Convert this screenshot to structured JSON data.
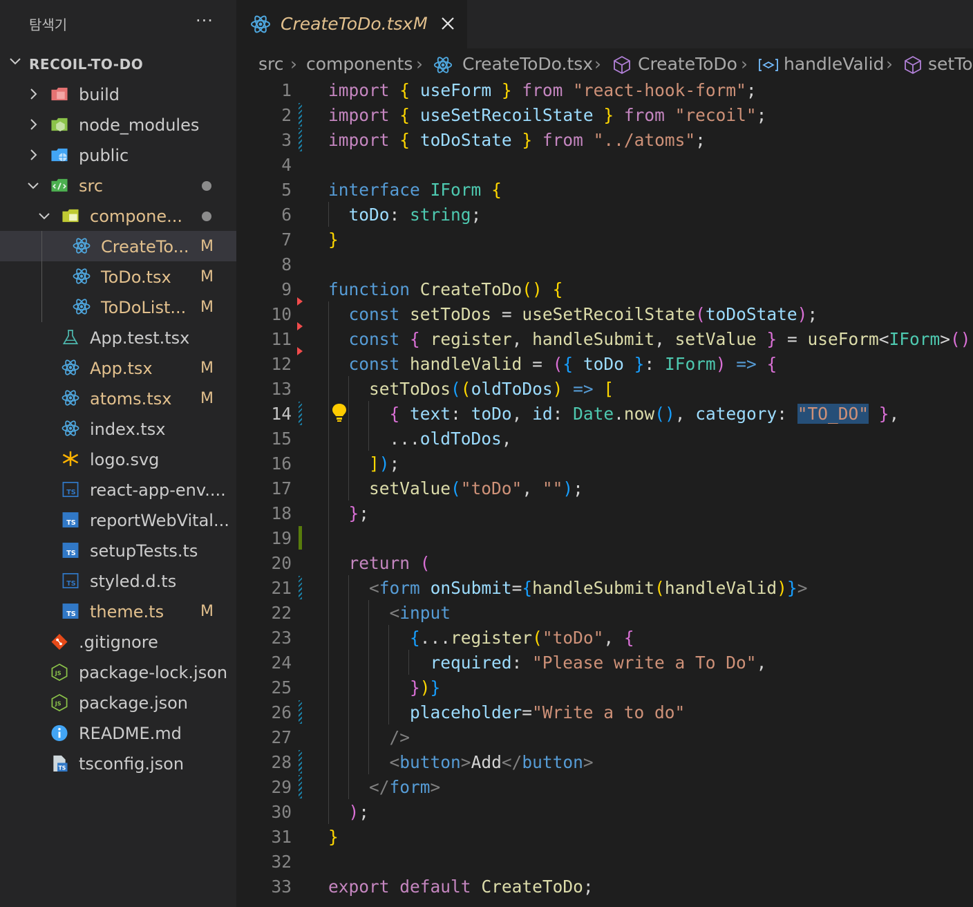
{
  "sidebar": {
    "title": "탐색기",
    "more": "···",
    "root": "RECOIL-TO-DO",
    "items": [
      {
        "label": "build",
        "badge": "",
        "color": "#cccccc"
      },
      {
        "label": "node_modules",
        "badge": "",
        "color": "#cccccc"
      },
      {
        "label": "public",
        "badge": "",
        "color": "#cccccc"
      },
      {
        "label": "src",
        "badge": "",
        "color": "#e2c08d"
      },
      {
        "label": "compone...",
        "badge": "",
        "color": "#e2c08d"
      },
      {
        "label": "CreateTo...",
        "badge": "M",
        "color": "#e2c08d"
      },
      {
        "label": "ToDo.tsx",
        "badge": "M",
        "color": "#e2c08d"
      },
      {
        "label": "ToDoList...",
        "badge": "M",
        "color": "#e2c08d"
      },
      {
        "label": "App.test.tsx",
        "badge": "",
        "color": "#cccccc"
      },
      {
        "label": "App.tsx",
        "badge": "M",
        "color": "#e2c08d"
      },
      {
        "label": "atoms.tsx",
        "badge": "M",
        "color": "#e2c08d"
      },
      {
        "label": "index.tsx",
        "badge": "",
        "color": "#cccccc"
      },
      {
        "label": "logo.svg",
        "badge": "",
        "color": "#cccccc"
      },
      {
        "label": "react-app-env....",
        "badge": "",
        "color": "#cccccc"
      },
      {
        "label": "reportWebVital...",
        "badge": "",
        "color": "#cccccc"
      },
      {
        "label": "setupTests.ts",
        "badge": "",
        "color": "#cccccc"
      },
      {
        "label": "styled.d.ts",
        "badge": "",
        "color": "#cccccc"
      },
      {
        "label": "theme.ts",
        "badge": "M",
        "color": "#e2c08d"
      },
      {
        "label": ".gitignore",
        "badge": "",
        "color": "#cccccc"
      },
      {
        "label": "package-lock.json",
        "badge": "",
        "color": "#cccccc"
      },
      {
        "label": "package.json",
        "badge": "",
        "color": "#cccccc"
      },
      {
        "label": "README.md",
        "badge": "",
        "color": "#cccccc"
      },
      {
        "label": "tsconfig.json",
        "badge": "",
        "color": "#cccccc"
      }
    ]
  },
  "tab": {
    "title": "CreateToDo.tsx",
    "badge": "M"
  },
  "breadcrumb": [
    "src",
    "components",
    "CreateToDo.tsx",
    "CreateToDo",
    "handleValid",
    "setTo"
  ],
  "code": {
    "active_line": 14,
    "lines": [
      [
        [
          "kw",
          "import"
        ],
        [
          "op",
          " "
        ],
        [
          "b1",
          "{"
        ],
        [
          "op",
          " "
        ],
        [
          "vr",
          "useForm"
        ],
        [
          "op",
          " "
        ],
        [
          "b1",
          "}"
        ],
        [
          "op",
          " "
        ],
        [
          "kw",
          "from"
        ],
        [
          "op",
          " "
        ],
        [
          "st",
          "\"react-hook-form\""
        ],
        [
          "op",
          ";"
        ]
      ],
      [
        [
          "kw",
          "import"
        ],
        [
          "op",
          " "
        ],
        [
          "b1",
          "{"
        ],
        [
          "op",
          " "
        ],
        [
          "vr",
          "useSetRecoilState"
        ],
        [
          "op",
          " "
        ],
        [
          "b1",
          "}"
        ],
        [
          "op",
          " "
        ],
        [
          "kw",
          "from"
        ],
        [
          "op",
          " "
        ],
        [
          "st",
          "\"recoil\""
        ],
        [
          "op",
          ";"
        ]
      ],
      [
        [
          "kw",
          "import"
        ],
        [
          "op",
          " "
        ],
        [
          "b1",
          "{"
        ],
        [
          "op",
          " "
        ],
        [
          "vr",
          "toDoState"
        ],
        [
          "op",
          " "
        ],
        [
          "b1",
          "}"
        ],
        [
          "op",
          " "
        ],
        [
          "kw",
          "from"
        ],
        [
          "op",
          " "
        ],
        [
          "st",
          "\"../atoms\""
        ],
        [
          "op",
          ";"
        ]
      ],
      [],
      [
        [
          "kb",
          "interface"
        ],
        [
          "op",
          " "
        ],
        [
          "ty",
          "IForm"
        ],
        [
          "op",
          " "
        ],
        [
          "b1",
          "{"
        ]
      ],
      [
        [
          "op",
          "  "
        ],
        [
          "vr",
          "toDo"
        ],
        [
          "op",
          ": "
        ],
        [
          "ty",
          "string"
        ],
        [
          "op",
          ";"
        ]
      ],
      [
        [
          "b1",
          "}"
        ]
      ],
      [],
      [
        [
          "kb",
          "function"
        ],
        [
          "op",
          " "
        ],
        [
          "fn",
          "CreateToDo"
        ],
        [
          "b1",
          "()"
        ],
        [
          "op",
          " "
        ],
        [
          "b1",
          "{"
        ]
      ],
      [
        [
          "op",
          "  "
        ],
        [
          "kb",
          "const"
        ],
        [
          "op",
          " "
        ],
        [
          "fn",
          "setToDos"
        ],
        [
          "op",
          " = "
        ],
        [
          "fn",
          "useSetRecoilState"
        ],
        [
          "b2",
          "("
        ],
        [
          "vr",
          "toDoState"
        ],
        [
          "b2",
          ")"
        ],
        [
          "op",
          ";"
        ]
      ],
      [
        [
          "op",
          "  "
        ],
        [
          "kb",
          "const"
        ],
        [
          "op",
          " "
        ],
        [
          "b2",
          "{"
        ],
        [
          "op",
          " "
        ],
        [
          "fn",
          "register"
        ],
        [
          "op",
          ", "
        ],
        [
          "fn",
          "handleSubmit"
        ],
        [
          "op",
          ", "
        ],
        [
          "fn",
          "setValue"
        ],
        [
          "op",
          " "
        ],
        [
          "b2",
          "}"
        ],
        [
          "op",
          " = "
        ],
        [
          "fn",
          "useForm"
        ],
        [
          "op",
          "<"
        ],
        [
          "ty",
          "IForm"
        ],
        [
          "op",
          ">"
        ],
        [
          "b2",
          "()"
        ],
        [
          "op",
          ";"
        ]
      ],
      [
        [
          "op",
          "  "
        ],
        [
          "kb",
          "const"
        ],
        [
          "op",
          " "
        ],
        [
          "fn",
          "handleValid"
        ],
        [
          "op",
          " = "
        ],
        [
          "b2",
          "("
        ],
        [
          "b3",
          "{"
        ],
        [
          "op",
          " "
        ],
        [
          "vr",
          "toDo"
        ],
        [
          "op",
          " "
        ],
        [
          "b3",
          "}"
        ],
        [
          "op",
          ": "
        ],
        [
          "ty",
          "IForm"
        ],
        [
          "b2",
          ")"
        ],
        [
          "op",
          " "
        ],
        [
          "kb",
          "=>"
        ],
        [
          "op",
          " "
        ],
        [
          "b2",
          "{"
        ]
      ],
      [
        [
          "op",
          "    "
        ],
        [
          "fn",
          "setToDos"
        ],
        [
          "b3",
          "("
        ],
        [
          "b1",
          "("
        ],
        [
          "vr",
          "oldToDos"
        ],
        [
          "b1",
          ")"
        ],
        [
          "op",
          " "
        ],
        [
          "kb",
          "=>"
        ],
        [
          "op",
          " "
        ],
        [
          "b1",
          "["
        ]
      ],
      [
        [
          "op",
          "      "
        ],
        [
          "b2",
          "{"
        ],
        [
          "op",
          " "
        ],
        [
          "vr",
          "text"
        ],
        [
          "op",
          ": "
        ],
        [
          "vr",
          "toDo"
        ],
        [
          "op",
          ", "
        ],
        [
          "vr",
          "id"
        ],
        [
          "op",
          ": "
        ],
        [
          "ty",
          "Date"
        ],
        [
          "op",
          "."
        ],
        [
          "fn",
          "now"
        ],
        [
          "b3",
          "()"
        ],
        [
          "op",
          ", "
        ],
        [
          "vr",
          "category"
        ],
        [
          "op",
          ": "
        ],
        [
          "hl",
          "\"TO_DO\""
        ],
        [
          "op",
          " "
        ],
        [
          "b2",
          "}"
        ],
        [
          "op",
          ","
        ]
      ],
      [
        [
          "op",
          "      ..."
        ],
        [
          "vr",
          "oldToDos"
        ],
        [
          "op",
          ","
        ]
      ],
      [
        [
          "op",
          "    "
        ],
        [
          "b1",
          "]"
        ],
        [
          "b3",
          ")"
        ],
        [
          "op",
          ";"
        ]
      ],
      [
        [
          "op",
          "    "
        ],
        [
          "fn",
          "setValue"
        ],
        [
          "b3",
          "("
        ],
        [
          "st",
          "\"toDo\""
        ],
        [
          "op",
          ", "
        ],
        [
          "st",
          "\"\""
        ],
        [
          "b3",
          ")"
        ],
        [
          "op",
          ";"
        ]
      ],
      [
        [
          "op",
          "  "
        ],
        [
          "b2",
          "}"
        ],
        [
          "op",
          ";"
        ]
      ],
      [],
      [
        [
          "op",
          "  "
        ],
        [
          "kw",
          "return"
        ],
        [
          "op",
          " "
        ],
        [
          "b2",
          "("
        ]
      ],
      [
        [
          "op",
          "    "
        ],
        [
          "pt",
          "<"
        ],
        [
          "tg",
          "form"
        ],
        [
          "op",
          " "
        ],
        [
          "an",
          "onSubmit"
        ],
        [
          "op",
          "="
        ],
        [
          "b3",
          "{"
        ],
        [
          "fn",
          "handleSubmit"
        ],
        [
          "b1",
          "("
        ],
        [
          "fn",
          "handleValid"
        ],
        [
          "b1",
          ")"
        ],
        [
          "b3",
          "}"
        ],
        [
          "pt",
          ">"
        ]
      ],
      [
        [
          "op",
          "      "
        ],
        [
          "pt",
          "<"
        ],
        [
          "tg",
          "input"
        ]
      ],
      [
        [
          "op",
          "        "
        ],
        [
          "b3",
          "{"
        ],
        [
          "op",
          "..."
        ],
        [
          "fn",
          "register"
        ],
        [
          "b1",
          "("
        ],
        [
          "st",
          "\"toDo\""
        ],
        [
          "op",
          ", "
        ],
        [
          "b2",
          "{"
        ]
      ],
      [
        [
          "op",
          "          "
        ],
        [
          "vr",
          "required"
        ],
        [
          "op",
          ": "
        ],
        [
          "st",
          "\"Please write a To Do\""
        ],
        [
          "op",
          ","
        ]
      ],
      [
        [
          "op",
          "        "
        ],
        [
          "b2",
          "}"
        ],
        [
          "b1",
          ")"
        ],
        [
          "b3",
          "}"
        ]
      ],
      [
        [
          "op",
          "        "
        ],
        [
          "an",
          "placeholder"
        ],
        [
          "op",
          "="
        ],
        [
          "st",
          "\"Write a to do\""
        ]
      ],
      [
        [
          "op",
          "      "
        ],
        [
          "pt",
          "/>"
        ]
      ],
      [
        [
          "op",
          "      "
        ],
        [
          "pt",
          "<"
        ],
        [
          "tg",
          "button"
        ],
        [
          "pt",
          ">"
        ],
        [
          "op",
          "Add"
        ],
        [
          "pt",
          "</"
        ],
        [
          "tg",
          "button"
        ],
        [
          "pt",
          ">"
        ]
      ],
      [
        [
          "op",
          "    "
        ],
        [
          "pt",
          "</"
        ],
        [
          "tg",
          "form"
        ],
        [
          "pt",
          ">"
        ]
      ],
      [
        [
          "op",
          "  "
        ],
        [
          "b2",
          ")"
        ],
        [
          "op",
          ";"
        ]
      ],
      [
        [
          "b1",
          "}"
        ]
      ],
      [],
      [
        [
          "kw",
          "export"
        ],
        [
          "op",
          " "
        ],
        [
          "kw",
          "default"
        ],
        [
          "op",
          " "
        ],
        [
          "fn",
          "CreateToDo"
        ],
        [
          "op",
          ";"
        ]
      ]
    ]
  },
  "gutter": {
    "modified": [
      2,
      3,
      14,
      21,
      26,
      28,
      29
    ],
    "added": [
      19
    ],
    "deleted": [
      10,
      11,
      12
    ]
  }
}
